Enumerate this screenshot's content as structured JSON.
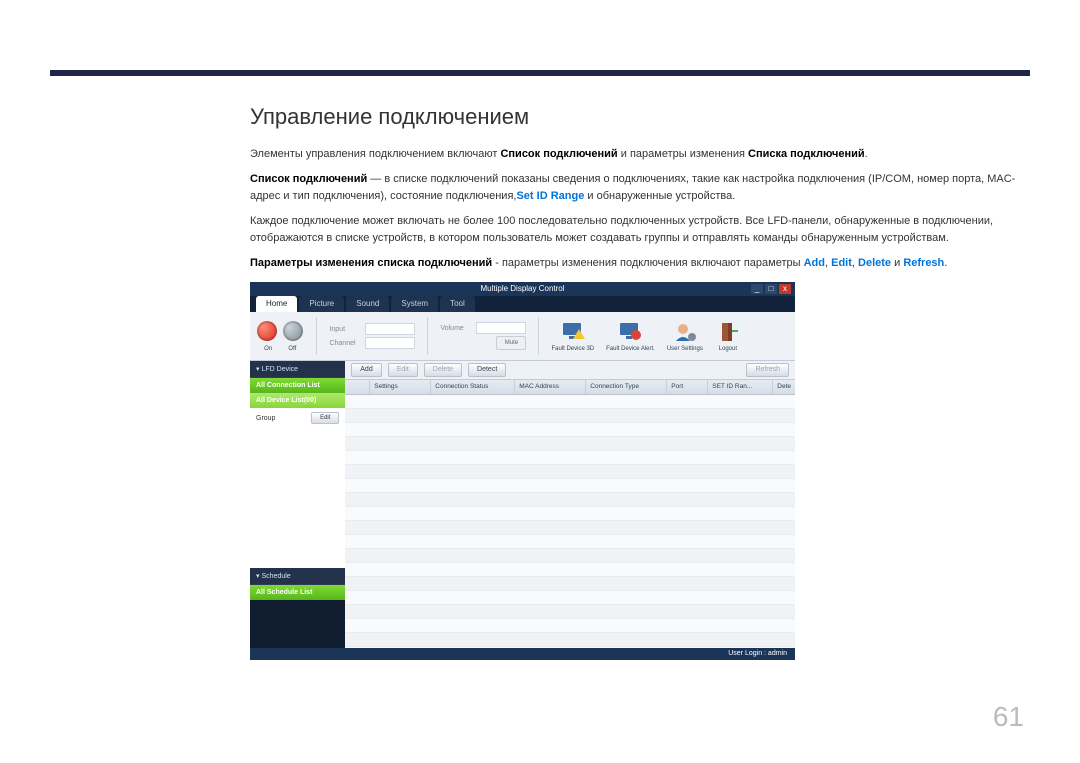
{
  "page": {
    "title": "Управление подключением",
    "page_number": "61",
    "para1_prefix": "Элементы управления подключением включают ",
    "para1_b1": "Список подключений",
    "para1_mid": " и параметры изменения ",
    "para1_b2": "Списка подключений",
    "para1_suffix": ".",
    "para2_b": "Список подключений",
    "para2_txt1": " — в списке подключений показаны сведения о подключениях, такие как настройка подключения (IP/COM, номер порта, MAC-адрес и тип подключения), состояние подключения,",
    "para2_link": "Set ID Range",
    "para2_txt2": " и обнаруженные устройства.",
    "para3": "Каждое подключение может включать не более 100 последовательно подключенных устройств. Все LFD-панели, обнаруженные в подключении, отображаются в списке устройств, в котором пользователь может создавать группы и отправлять команды обнаруженным устройствам.",
    "para4_b": "Параметры изменения списка подключений",
    "para4_txt1": " - параметры изменения подключения включают параметры ",
    "para4_add": "Add",
    "para4_c1": ", ",
    "para4_edit": "Edit",
    "para4_c2": ", ",
    "para4_delete": "Delete",
    "para4_and": " и ",
    "para4_refresh": "Refresh",
    "para4_end": "."
  },
  "app": {
    "title": "Multiple Display Control",
    "tabs": [
      "Home",
      "Picture",
      "Sound",
      "System",
      "Tool"
    ],
    "ribbon": {
      "on": "On",
      "off": "Off",
      "input": "Input",
      "channel": "Channel",
      "volume": "Volume",
      "mute": "Mute",
      "fault3d": "Fault Device 3D",
      "faultalert": "Fault Device Alert.",
      "usersettings": "User Settings",
      "logout": "Logout"
    },
    "sidebar": {
      "lfd": "LFD Device",
      "allconn": "All Connection List",
      "alldev": "All Device List(00)",
      "group": "Group",
      "edit": "Edit",
      "schedule": "Schedule",
      "allsched": "All Schedule List"
    },
    "toolbar": {
      "add": "Add",
      "edit": "Edit",
      "delete": "Delete",
      "detect": "Detect",
      "refresh": "Refresh"
    },
    "grid": {
      "c1": "Settings",
      "c2": "Connection Status",
      "c3": "MAC Address",
      "c4": "Connection Type",
      "c5": "Port",
      "c6": "SET ID Ran...",
      "c7": "Dete"
    },
    "status": "User Login : admin"
  }
}
